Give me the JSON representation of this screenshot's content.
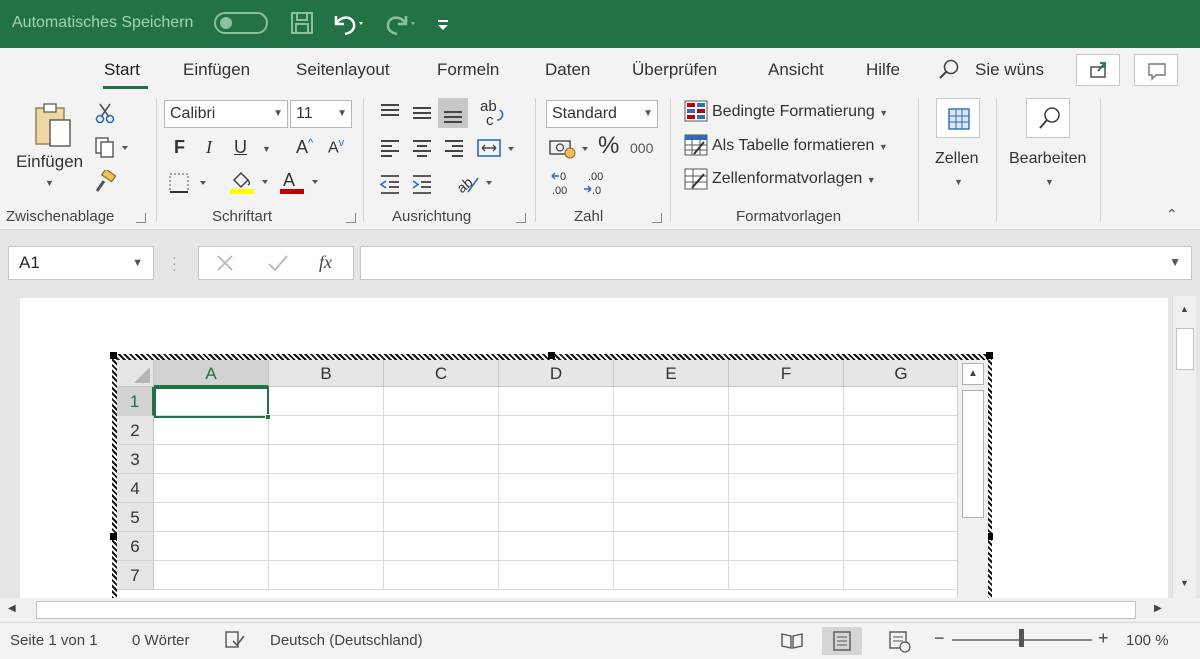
{
  "titlebar": {
    "autosave_label": "Automatisches Speichern",
    "icons": [
      "save-icon",
      "undo-icon",
      "redo-icon",
      "customize-icon"
    ]
  },
  "tabs": [
    {
      "label": "Start",
      "active": true
    },
    {
      "label": "Einfügen"
    },
    {
      "label": "Seitenlayout"
    },
    {
      "label": "Formeln"
    },
    {
      "label": "Daten"
    },
    {
      "label": "Überprüfen"
    },
    {
      "label": "Ansicht"
    },
    {
      "label": "Hilfe"
    }
  ],
  "search": {
    "label": "Sie wüns"
  },
  "ribbon": {
    "clipboard": {
      "paste_label": "Einfügen",
      "group_label": "Zwischenablage"
    },
    "font": {
      "name": "Calibri",
      "size": "11",
      "bold": "F",
      "italic": "I",
      "underline": "U",
      "grow": "A",
      "shrink": "A",
      "font_color_letter": "A",
      "group_label": "Schriftart",
      "highlight_color": "#ffff00",
      "font_color": "#c00000"
    },
    "alignment": {
      "group_label": "Ausrichtung",
      "wrap_text": "ab"
    },
    "number": {
      "format": "Standard",
      "percent": "%",
      "thousands": "000",
      "group_label": "Zahl"
    },
    "styles": {
      "conditional": "Bedingte Formatierung",
      "as_table": "Als Tabelle formatieren",
      "cell_styles": "Zellenformatvorlagen",
      "group_label": "Formatvorlagen"
    },
    "cells": {
      "label": "Zellen"
    },
    "editing": {
      "label": "Bearbeiten"
    }
  },
  "formula_bar": {
    "name_box": "A1",
    "fx": "fx",
    "value": ""
  },
  "sheet": {
    "columns": [
      "A",
      "B",
      "C",
      "D",
      "E",
      "F",
      "G"
    ],
    "rows": [
      "1",
      "2",
      "3",
      "4",
      "5",
      "6",
      "7"
    ],
    "active_cell": "A1"
  },
  "status": {
    "page": "Seite 1 von 1",
    "words": "0 Wörter",
    "language": "Deutsch (Deutschland)",
    "zoom": "100 %"
  },
  "colors": {
    "accent": "#217346"
  }
}
